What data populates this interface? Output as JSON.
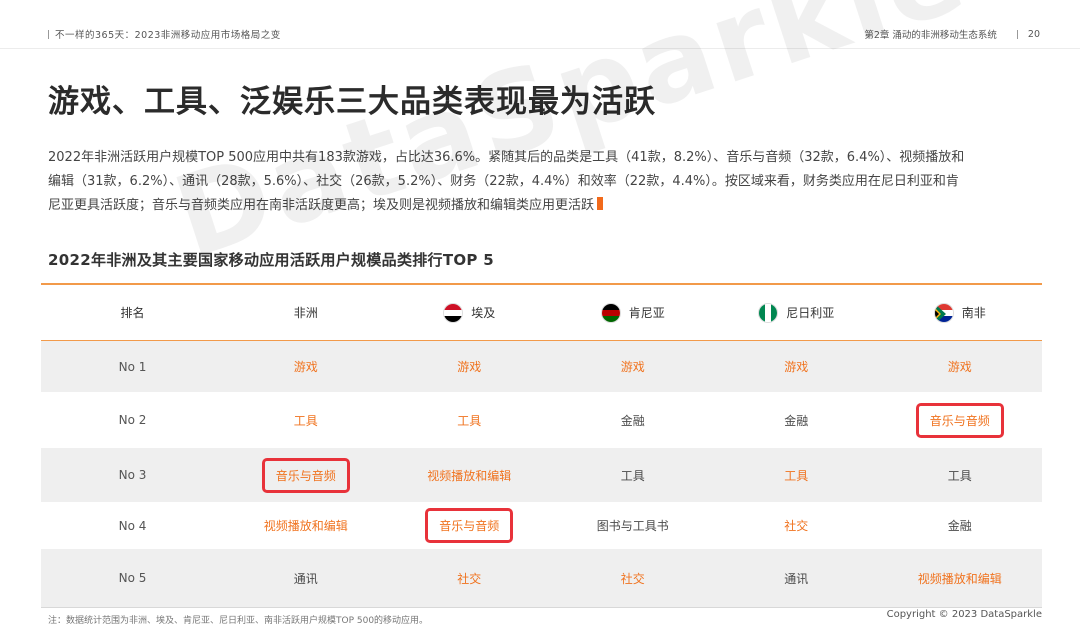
{
  "header": {
    "left": "不一样的365天：2023非洲移动应用市场格局之变",
    "chapter": "第2章 涌动的非洲移动生态系统",
    "page": "20"
  },
  "title": "游戏、工具、泛娱乐三大品类表现最为活跃",
  "summary": "2022年非洲活跃用户规模TOP 500应用中共有183款游戏，占比达36.6%。紧随其后的品类是工具（41款，8.2%）、音乐与音频（32款，6.4%）、视频播放和编辑（31款，6.2%）、通讯（28款，5.6%）、社交（26款，5.2%）、财务（22款，4.4%）和效率（22款，4.4%）。按区域来看，财务类应用在尼日利亚和肯尼亚更具活跃度；音乐与音频类应用在南非活跃度更高；埃及则是视频播放和编辑类应用更活跃",
  "watermark": "DataSparkle",
  "table": {
    "title": "2022年非洲及其主要国家移动应用活跃用户规模品类排行TOP 5",
    "headers": [
      "排名",
      "非洲",
      "埃及",
      "肯尼亚",
      "尼日利亚",
      "南非"
    ],
    "rows": [
      {
        "rank": "No 1",
        "cells": [
          "游戏",
          "游戏",
          "游戏",
          "游戏",
          "游戏"
        ]
      },
      {
        "rank": "No 2",
        "cells": [
          "工具",
          "工具",
          "金融",
          "金融",
          "音乐与音频"
        ]
      },
      {
        "rank": "No 3",
        "cells": [
          "音乐与音频",
          "视频播放和编辑",
          "工具",
          "工具",
          "工具"
        ]
      },
      {
        "rank": "No 4",
        "cells": [
          "视频播放和编辑",
          "音乐与音频",
          "图书与工具书",
          "社交",
          "金融"
        ]
      },
      {
        "rank": "No 5",
        "cells": [
          "通讯",
          "社交",
          "社交",
          "通讯",
          "视频播放和编辑"
        ]
      }
    ]
  },
  "colors": {
    "accent": "#f0731f",
    "highlight_box": "#e8323a",
    "row_shade": "#efefef"
  },
  "footnote": "注：数据统计范围为非洲、埃及、肯尼亚、尼日利亚、南非活跃用户规模TOP 500的移动应用。",
  "copyright": "Copyright © 2023 DataSparkle"
}
